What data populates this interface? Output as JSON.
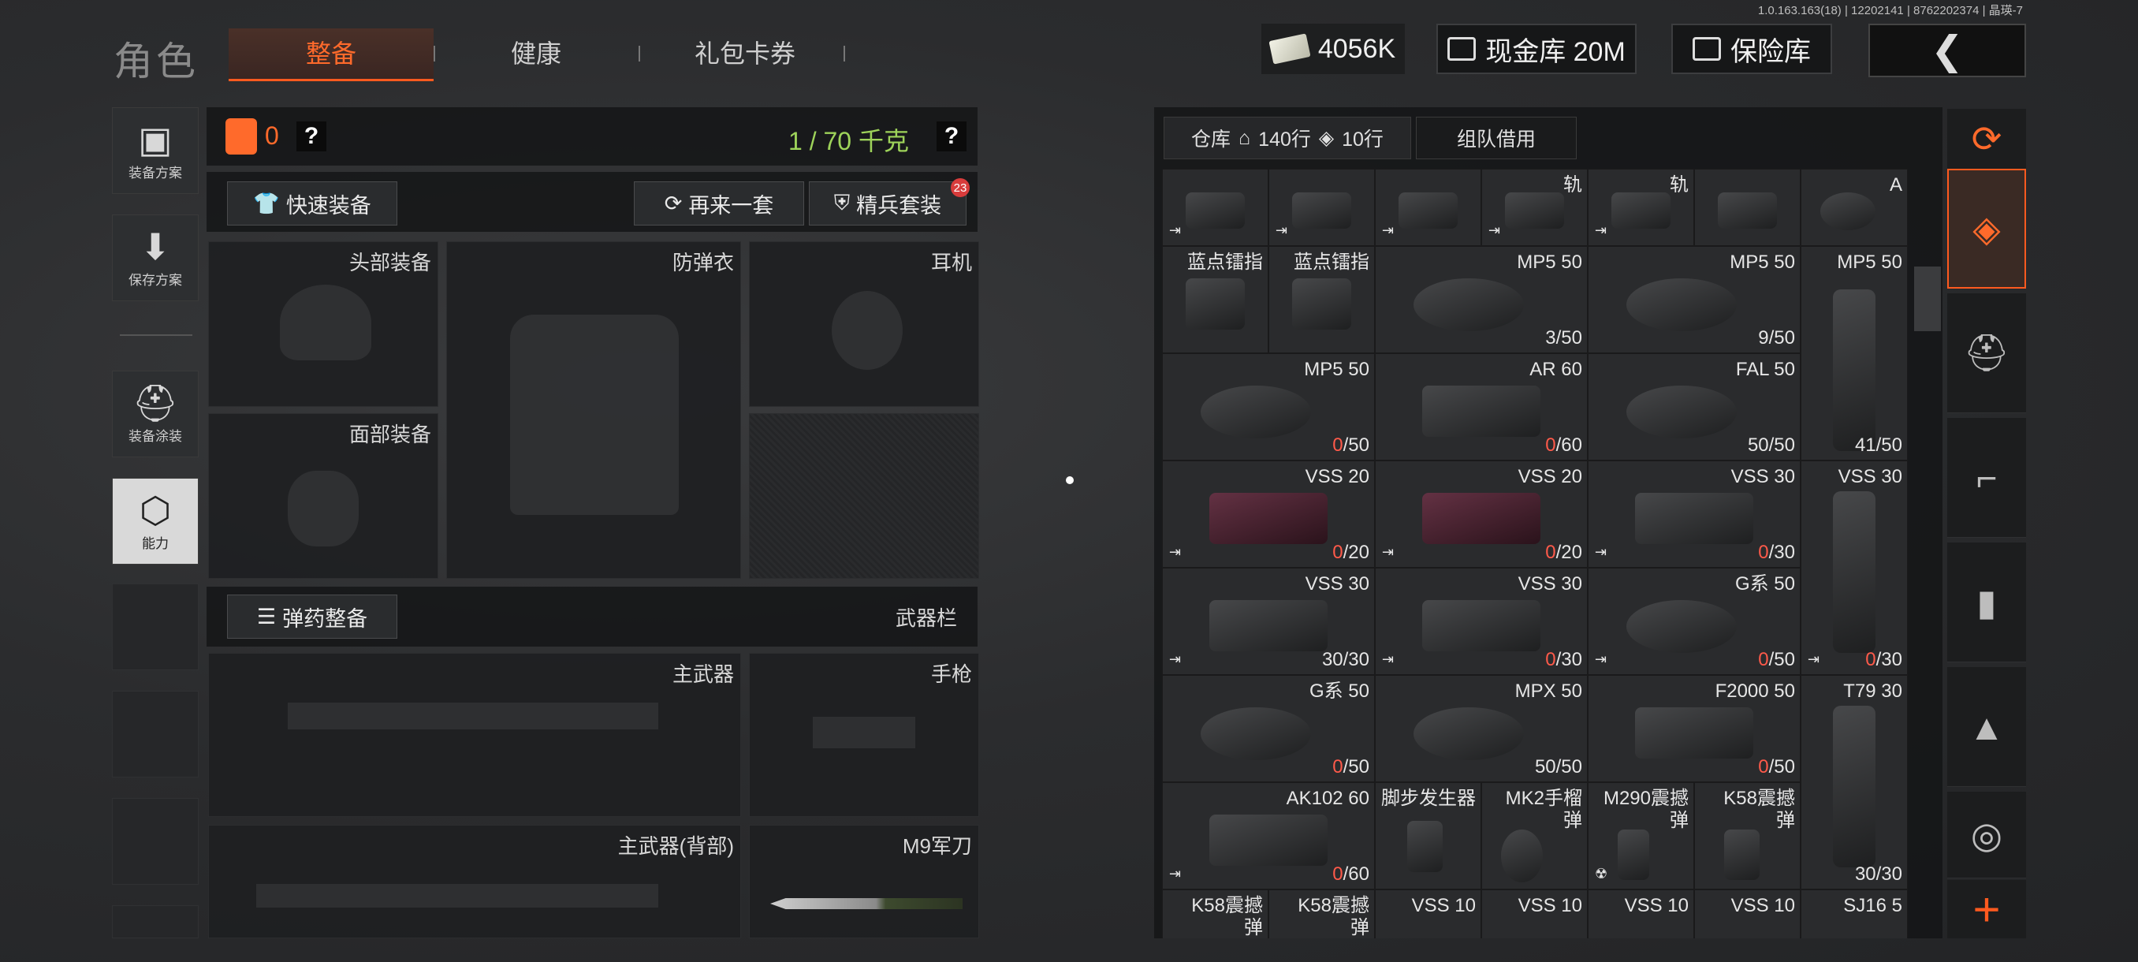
{
  "version": "1.0.163.163(18) | 12202141 | 8762202374 | 晶瑛-7",
  "title": "角色",
  "tabs": [
    {
      "label": "整备"
    },
    {
      "label": "健康"
    },
    {
      "label": "礼包卡券"
    }
  ],
  "topbar": {
    "cash": "4056K",
    "vault": "现金库 20M",
    "insurance": "保险库",
    "back_icon": "chevron-left-icon"
  },
  "sidebar": [
    {
      "label": "装备方案",
      "icon": "vest-icon"
    },
    {
      "label": "保存方案",
      "icon": "download-icon"
    },
    {
      "label": "装备涂装",
      "icon": "helmet-paint-icon"
    },
    {
      "label": "能力",
      "icon": "lightning-hex-icon"
    }
  ],
  "loadout": {
    "bag_count": "0",
    "weight": "1 / 70 千克",
    "help": "?",
    "quick_equip": "快速装备",
    "again": "再来一套",
    "elite": "精兵套装",
    "elite_badge": "23",
    "slots": {
      "head": "头部装备",
      "armor": "防弹衣",
      "headset": "耳机",
      "face": "面部装备"
    },
    "ammo_btn": "弹药整备",
    "weapon_bar": "武器栏",
    "weapons": {
      "primary": "主武器",
      "pistol": "手枪",
      "primary_back": "主武器(背部)",
      "knife": "M9军刀"
    }
  },
  "storage": {
    "tab_label": "仓库",
    "rows": "140行",
    "cols": "10行",
    "team_borrow": "组队借用",
    "row0": [
      {
        "name": ""
      },
      {
        "name": ""
      },
      {
        "name": ""
      },
      {
        "name": "轨"
      },
      {
        "name": "轨"
      },
      {
        "name": ""
      },
      {
        "name": "A"
      }
    ],
    "row1": [
      {
        "name": "蓝点镭指",
        "qty": ""
      },
      {
        "name": "蓝点镭指",
        "qty": ""
      },
      {
        "name": "MP5 50",
        "qty": "3/50"
      },
      {
        "name": "MP5 50",
        "qty": "9/50"
      },
      {
        "name": "MP5 50",
        "qty": ""
      }
    ],
    "row2": [
      {
        "name": "MP5 50",
        "qty_zero": "0",
        "qty_rest": "/50"
      },
      {
        "name": "AR 60",
        "qty_zero": "0",
        "qty_rest": "/60"
      },
      {
        "name": "FAL 50",
        "qty": "50/50"
      },
      {
        "name": "",
        "qty": "41/50"
      }
    ],
    "row3": [
      {
        "name": "VSS 20",
        "qty_zero": "0",
        "qty_rest": "/20"
      },
      {
        "name": "VSS 20",
        "qty_zero": "0",
        "qty_rest": "/20"
      },
      {
        "name": "VSS 30",
        "qty_zero": "0",
        "qty_rest": "/30"
      },
      {
        "name": "VSS 30"
      }
    ],
    "row4": [
      {
        "name": "VSS 30",
        "qty": "30/30"
      },
      {
        "name": "VSS 30",
        "qty_zero": "0",
        "qty_rest": "/30"
      },
      {
        "name": "G系 50",
        "qty_zero": "0",
        "qty_rest": "/50"
      },
      {
        "qty_zero": "0",
        "qty_rest": "/30"
      }
    ],
    "row5": [
      {
        "name": "G系 50",
        "qty_zero": "0",
        "qty_rest": "/50"
      },
      {
        "name": "MPX 50",
        "qty": "50/50"
      },
      {
        "name": "F2000 50",
        "qty_zero": "0",
        "qty_rest": "/50"
      },
      {
        "name": "T79 30"
      }
    ],
    "row6": [
      {
        "name": "AK102 60",
        "qty_zero": "0",
        "qty_rest": "/60"
      },
      {
        "name": "脚步发生器"
      },
      {
        "name": "MK2手榴\n弹"
      },
      {
        "name": "M290震撼\n弹"
      },
      {
        "name": "K58震撼\n弹"
      },
      {
        "qty": "30/30"
      }
    ],
    "row7": [
      {
        "name": "K58震撼\n弹"
      },
      {
        "name": "K58震撼\n弹"
      },
      {
        "name": "VSS 10"
      },
      {
        "name": "VSS 10"
      },
      {
        "name": "VSS 10"
      },
      {
        "name": "VSS 10"
      },
      {
        "name": "SJ16 5"
      }
    ]
  },
  "right_tabs": [
    {
      "icon": "refresh-stack-icon"
    },
    {
      "icon": "layers-icon"
    },
    {
      "icon": "helmet-icon"
    },
    {
      "icon": "rifle-icon"
    },
    {
      "icon": "magazine-icon"
    },
    {
      "icon": "bullet-icon"
    },
    {
      "icon": "scope-icon"
    }
  ],
  "colors": {
    "accent": "#ff5a1f",
    "weight_green": "#9ed35a",
    "empty_red": "#ff5a4a"
  }
}
